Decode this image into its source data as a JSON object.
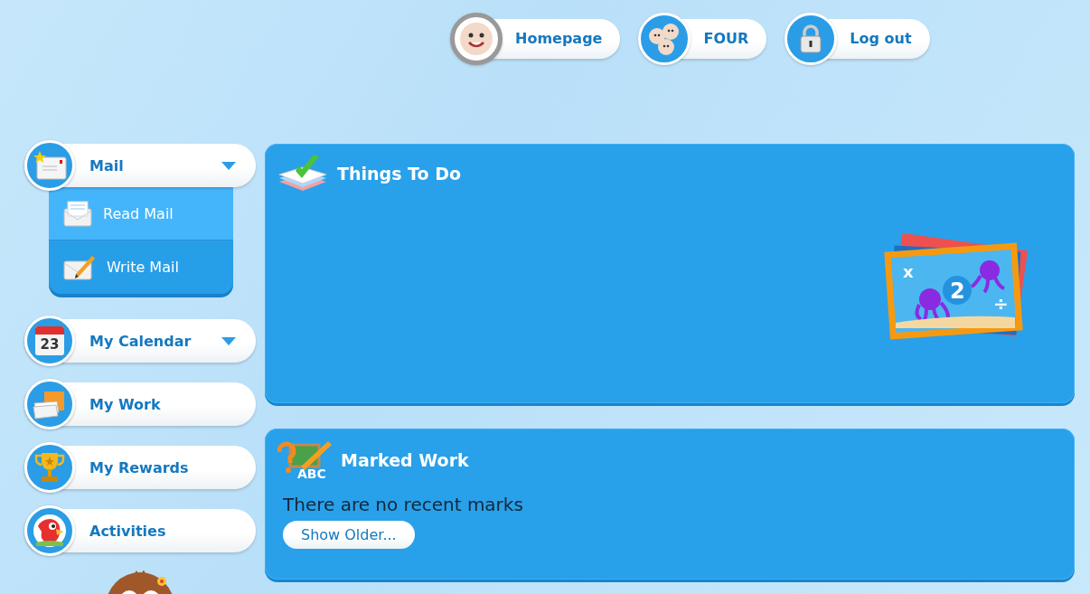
{
  "top_nav": [
    {
      "label": "Homepage",
      "kind": "face"
    },
    {
      "label": "FOUR",
      "kind": "group"
    },
    {
      "label": "Log out",
      "kind": "lock"
    }
  ],
  "sidebar": {
    "items": [
      {
        "label": "Mail",
        "kind": "mail",
        "expanded": true,
        "children": [
          {
            "label": "Read Mail",
            "kind": "read",
            "selected": true
          },
          {
            "label": "Write Mail",
            "kind": "write",
            "selected": false
          }
        ]
      },
      {
        "label": "My Calendar",
        "kind": "calendar",
        "expanded": false,
        "icon_text": "23"
      },
      {
        "label": "My Work",
        "kind": "work"
      },
      {
        "label": "My Rewards",
        "kind": "trophy"
      },
      {
        "label": "Activities",
        "kind": "parrot"
      }
    ]
  },
  "panels": [
    {
      "title": "Things To Do",
      "kind": "todo",
      "card_texts": [
        "x",
        "2",
        "÷"
      ]
    },
    {
      "title": "Marked Work",
      "kind": "marked",
      "icon_text": "ABC",
      "message": "There are no recent marks",
      "button": "Show Older..."
    }
  ]
}
